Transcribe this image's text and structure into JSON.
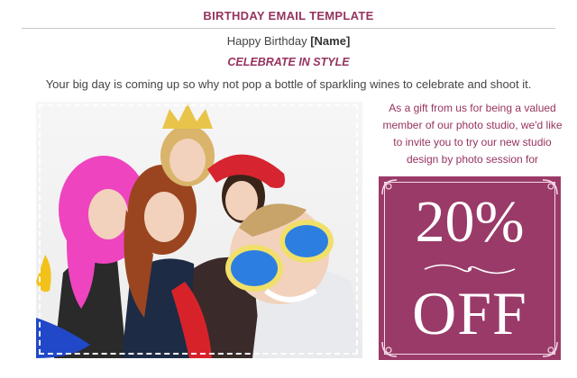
{
  "header": {
    "title": "BIRTHDAY EMAIL TEMPLATE"
  },
  "greeting": {
    "prefix": "Happy Birthday ",
    "name_tag": "[Name]"
  },
  "tagline": "CELEBRATE IN STYLE",
  "intro": "Your big day is coming up so why not pop a bottle of sparkling wines to celebrate and shoot it.",
  "gift_text": "As a gift from us for being a valued member of our photo studio, we'd like to invite you to try our new studio design by photo session for",
  "coupon": {
    "percent": "20%",
    "off": "OFF"
  },
  "colors": {
    "brand": "#96325f",
    "coupon_bg": "#9a3a68",
    "text": "#444444"
  },
  "icons": {
    "corner": "ornament-corner-icon",
    "flourish": "flourish-divider-icon"
  }
}
